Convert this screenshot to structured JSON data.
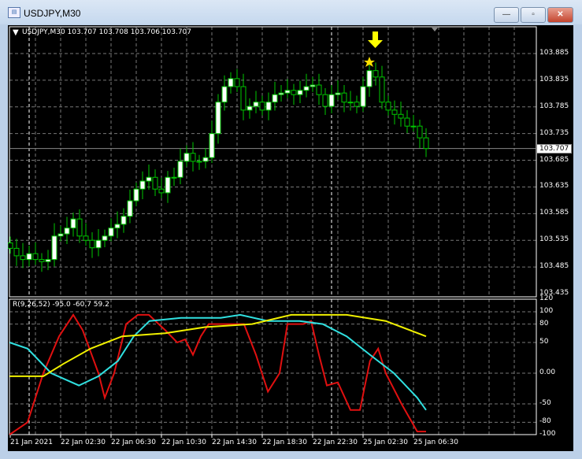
{
  "window": {
    "title": "USDJPY,M30",
    "minimize": "—",
    "maximize": "▫",
    "close": "✕"
  },
  "chart": {
    "header": "USDJPY,M30  103.707 103.708 103.706 103.707",
    "current_price": "103.707",
    "price_ticks": [
      "103.885",
      "103.835",
      "103.785",
      "103.735",
      "103.685",
      "103.635",
      "103.585",
      "103.535",
      "103.485",
      "103.435"
    ],
    "time_labels": [
      "21 Jan 2021",
      "22 Jan 02:30",
      "22 Jan 06:30",
      "22 Jan 10:30",
      "22 Jan 14:30",
      "22 Jan 18:30",
      "22 Jan 22:30",
      "25 Jan 02:30",
      "25 Jan 06:30"
    ],
    "closes": [
      103.52,
      103.506,
      103.499,
      103.51,
      103.499,
      103.495,
      103.499,
      103.543,
      103.547,
      103.558,
      103.575,
      103.543,
      103.535,
      103.521,
      103.535,
      103.543,
      103.558,
      103.565,
      103.58,
      103.609,
      103.631,
      103.646,
      103.653,
      103.631,
      103.624,
      103.653,
      103.653,
      103.683,
      103.698,
      103.683,
      103.683,
      103.69,
      103.735,
      103.794,
      103.823,
      103.838,
      103.823,
      103.779,
      103.786,
      103.794,
      103.779,
      103.794,
      103.808,
      103.811,
      103.816,
      103.808,
      103.816,
      103.823,
      103.826,
      103.808,
      103.786,
      103.808,
      103.811,
      103.794,
      103.794,
      103.786,
      103.823,
      103.853,
      103.841,
      103.794,
      103.779,
      103.771,
      103.764,
      103.749,
      103.749,
      103.727,
      103.707
    ],
    "price_range": [
      103.435,
      103.885
    ],
    "colors": {
      "candle": "#00c800",
      "bull_fill": "#ffffff",
      "grid": "#c8c8c8",
      "arrow": "#ffff00"
    }
  },
  "oscillator": {
    "header": "R(9,26,52) -95.0 -60.7 59.2",
    "ticks": [
      "120",
      "100",
      "80",
      "50",
      "0.00",
      "-50",
      "-80",
      "-100"
    ],
    "tick_values": [
      120,
      100,
      80,
      50,
      0,
      -50,
      -80,
      -100
    ],
    "series": [
      {
        "name": "red",
        "color": "#e01010",
        "points": [
          [
            -0.1,
            -100
          ],
          [
            2.75,
            -80
          ],
          [
            5.25,
            0
          ],
          [
            7.75,
            60
          ],
          [
            10,
            95
          ],
          [
            11.5,
            70
          ],
          [
            14,
            0
          ],
          [
            15,
            -40
          ],
          [
            16.5,
            0
          ],
          [
            18.4,
            80
          ],
          [
            20.25,
            95
          ],
          [
            22,
            95
          ],
          [
            24.6,
            70
          ],
          [
            26.5,
            50
          ],
          [
            27.75,
            55
          ],
          [
            29,
            30
          ],
          [
            30.25,
            60
          ],
          [
            31.5,
            80
          ],
          [
            37.1,
            80
          ],
          [
            39,
            30
          ],
          [
            40.9,
            -30
          ],
          [
            42.75,
            0
          ],
          [
            44,
            80
          ],
          [
            46.5,
            80
          ],
          [
            47.75,
            85
          ],
          [
            49,
            30
          ],
          [
            50.25,
            -20
          ],
          [
            52,
            -15
          ],
          [
            54,
            -60
          ],
          [
            55.5,
            -60
          ],
          [
            57.1,
            20
          ],
          [
            58.4,
            40
          ],
          [
            59.6,
            0
          ],
          [
            62.1,
            -50
          ],
          [
            64.6,
            -95
          ],
          [
            66,
            -95
          ]
        ]
      },
      {
        "name": "cyan",
        "color": "#30e0e0",
        "points": [
          [
            -0.1,
            50
          ],
          [
            2.75,
            40
          ],
          [
            6.5,
            0
          ],
          [
            10.9,
            -20
          ],
          [
            14,
            -5
          ],
          [
            17.1,
            20
          ],
          [
            19.6,
            60
          ],
          [
            22.1,
            85
          ],
          [
            27.1,
            90
          ],
          [
            33.4,
            90
          ],
          [
            36.5,
            95
          ],
          [
            40.9,
            85
          ],
          [
            45.9,
            85
          ],
          [
            49.6,
            80
          ],
          [
            53.4,
            60
          ],
          [
            57.1,
            30
          ],
          [
            60.9,
            0
          ],
          [
            64.6,
            -40
          ],
          [
            66,
            -60
          ]
        ]
      },
      {
        "name": "yellow",
        "color": "#f0f000",
        "points": [
          [
            -0.1,
            -5
          ],
          [
            5.25,
            -5
          ],
          [
            8.4,
            15
          ],
          [
            12.75,
            40
          ],
          [
            17.75,
            60
          ],
          [
            24.6,
            65
          ],
          [
            30.9,
            75
          ],
          [
            38.4,
            80
          ],
          [
            44.6,
            95
          ],
          [
            53.4,
            95
          ],
          [
            59.6,
            85
          ],
          [
            66,
            60
          ]
        ]
      }
    ]
  }
}
